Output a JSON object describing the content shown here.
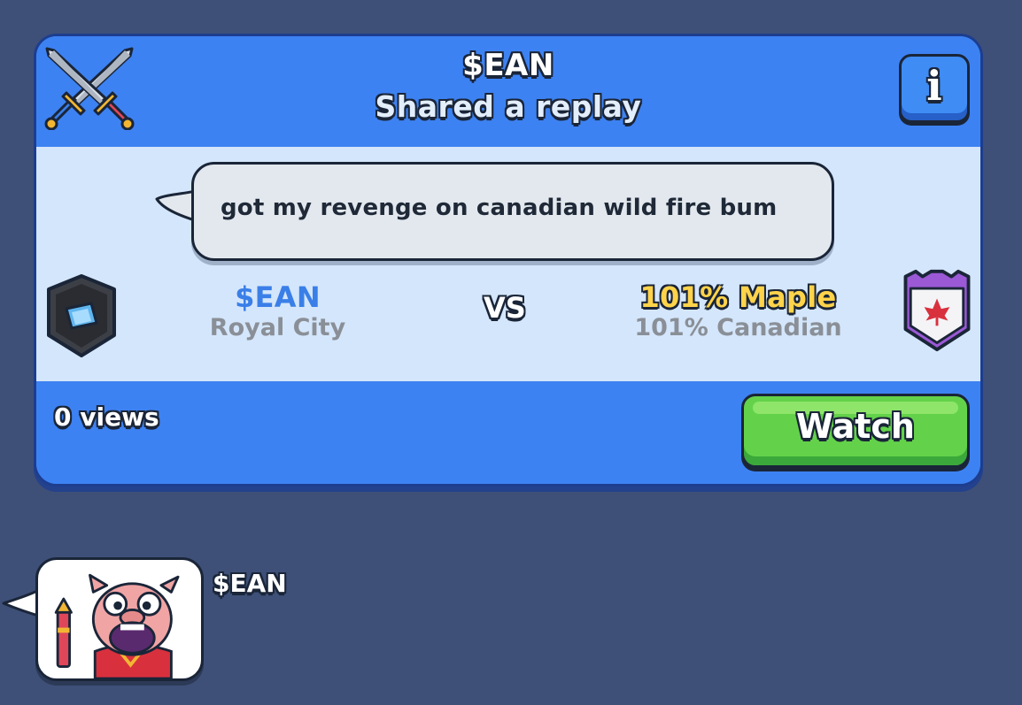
{
  "header": {
    "player_name": "$EAN",
    "subtitle": "Shared a replay",
    "info_button_label": "i"
  },
  "message": {
    "text": "got my revenge on canadian wild fire bum"
  },
  "match": {
    "vs_label": "VS",
    "left_player": {
      "name": "$EAN",
      "clan": "Royal City"
    },
    "right_player": {
      "name": "101% Maple",
      "clan": "101% Canadian"
    }
  },
  "footer": {
    "views": "0 views",
    "watch_label": "Watch"
  },
  "emote_message": {
    "sender": "$EAN",
    "emote_icon": "pig-firework-emote"
  },
  "colors": {
    "background": "#3e5078",
    "card_blue": "#3d82f2",
    "card_body": "#d4e6fb",
    "watch_green": "#63d24a",
    "left_name_blue": "#3a7fe8",
    "right_name_gold": "#ffd34a"
  }
}
